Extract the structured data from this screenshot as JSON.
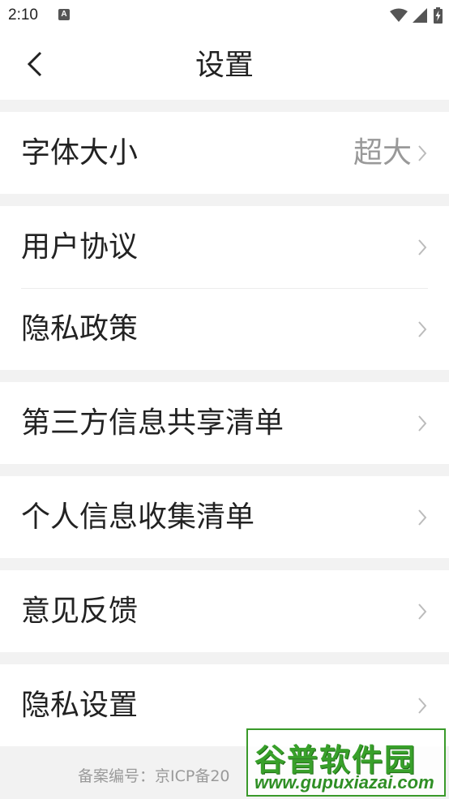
{
  "status_bar": {
    "time": "2:10",
    "notification_icon_letter": "A",
    "icons": [
      "wifi-icon",
      "signal-icon",
      "battery-charging-icon"
    ]
  },
  "header": {
    "title": "设置",
    "back_icon": "chevron-left-icon"
  },
  "groups": [
    {
      "items": [
        {
          "label": "字体大小",
          "value": "超大"
        }
      ]
    },
    {
      "items": [
        {
          "label": "用户协议"
        },
        {
          "label": "隐私政策"
        }
      ]
    },
    {
      "items": [
        {
          "label": "第三方信息共享清单"
        }
      ]
    },
    {
      "items": [
        {
          "label": "个人信息收集清单"
        }
      ]
    },
    {
      "items": [
        {
          "label": "意见反馈"
        }
      ]
    },
    {
      "items": [
        {
          "label": "隐私设置"
        }
      ]
    }
  ],
  "footer": {
    "icp_text": "备案编号：京ICP备20"
  },
  "watermark": {
    "brand": "谷普软件园",
    "url": "www.gupuxiazai.com"
  },
  "colors": {
    "background": "#f2f2f2",
    "card": "#ffffff",
    "text_primary": "#222222",
    "text_secondary": "#999999",
    "chevron": "#bbbbbb",
    "watermark_green": "#38a02a"
  }
}
